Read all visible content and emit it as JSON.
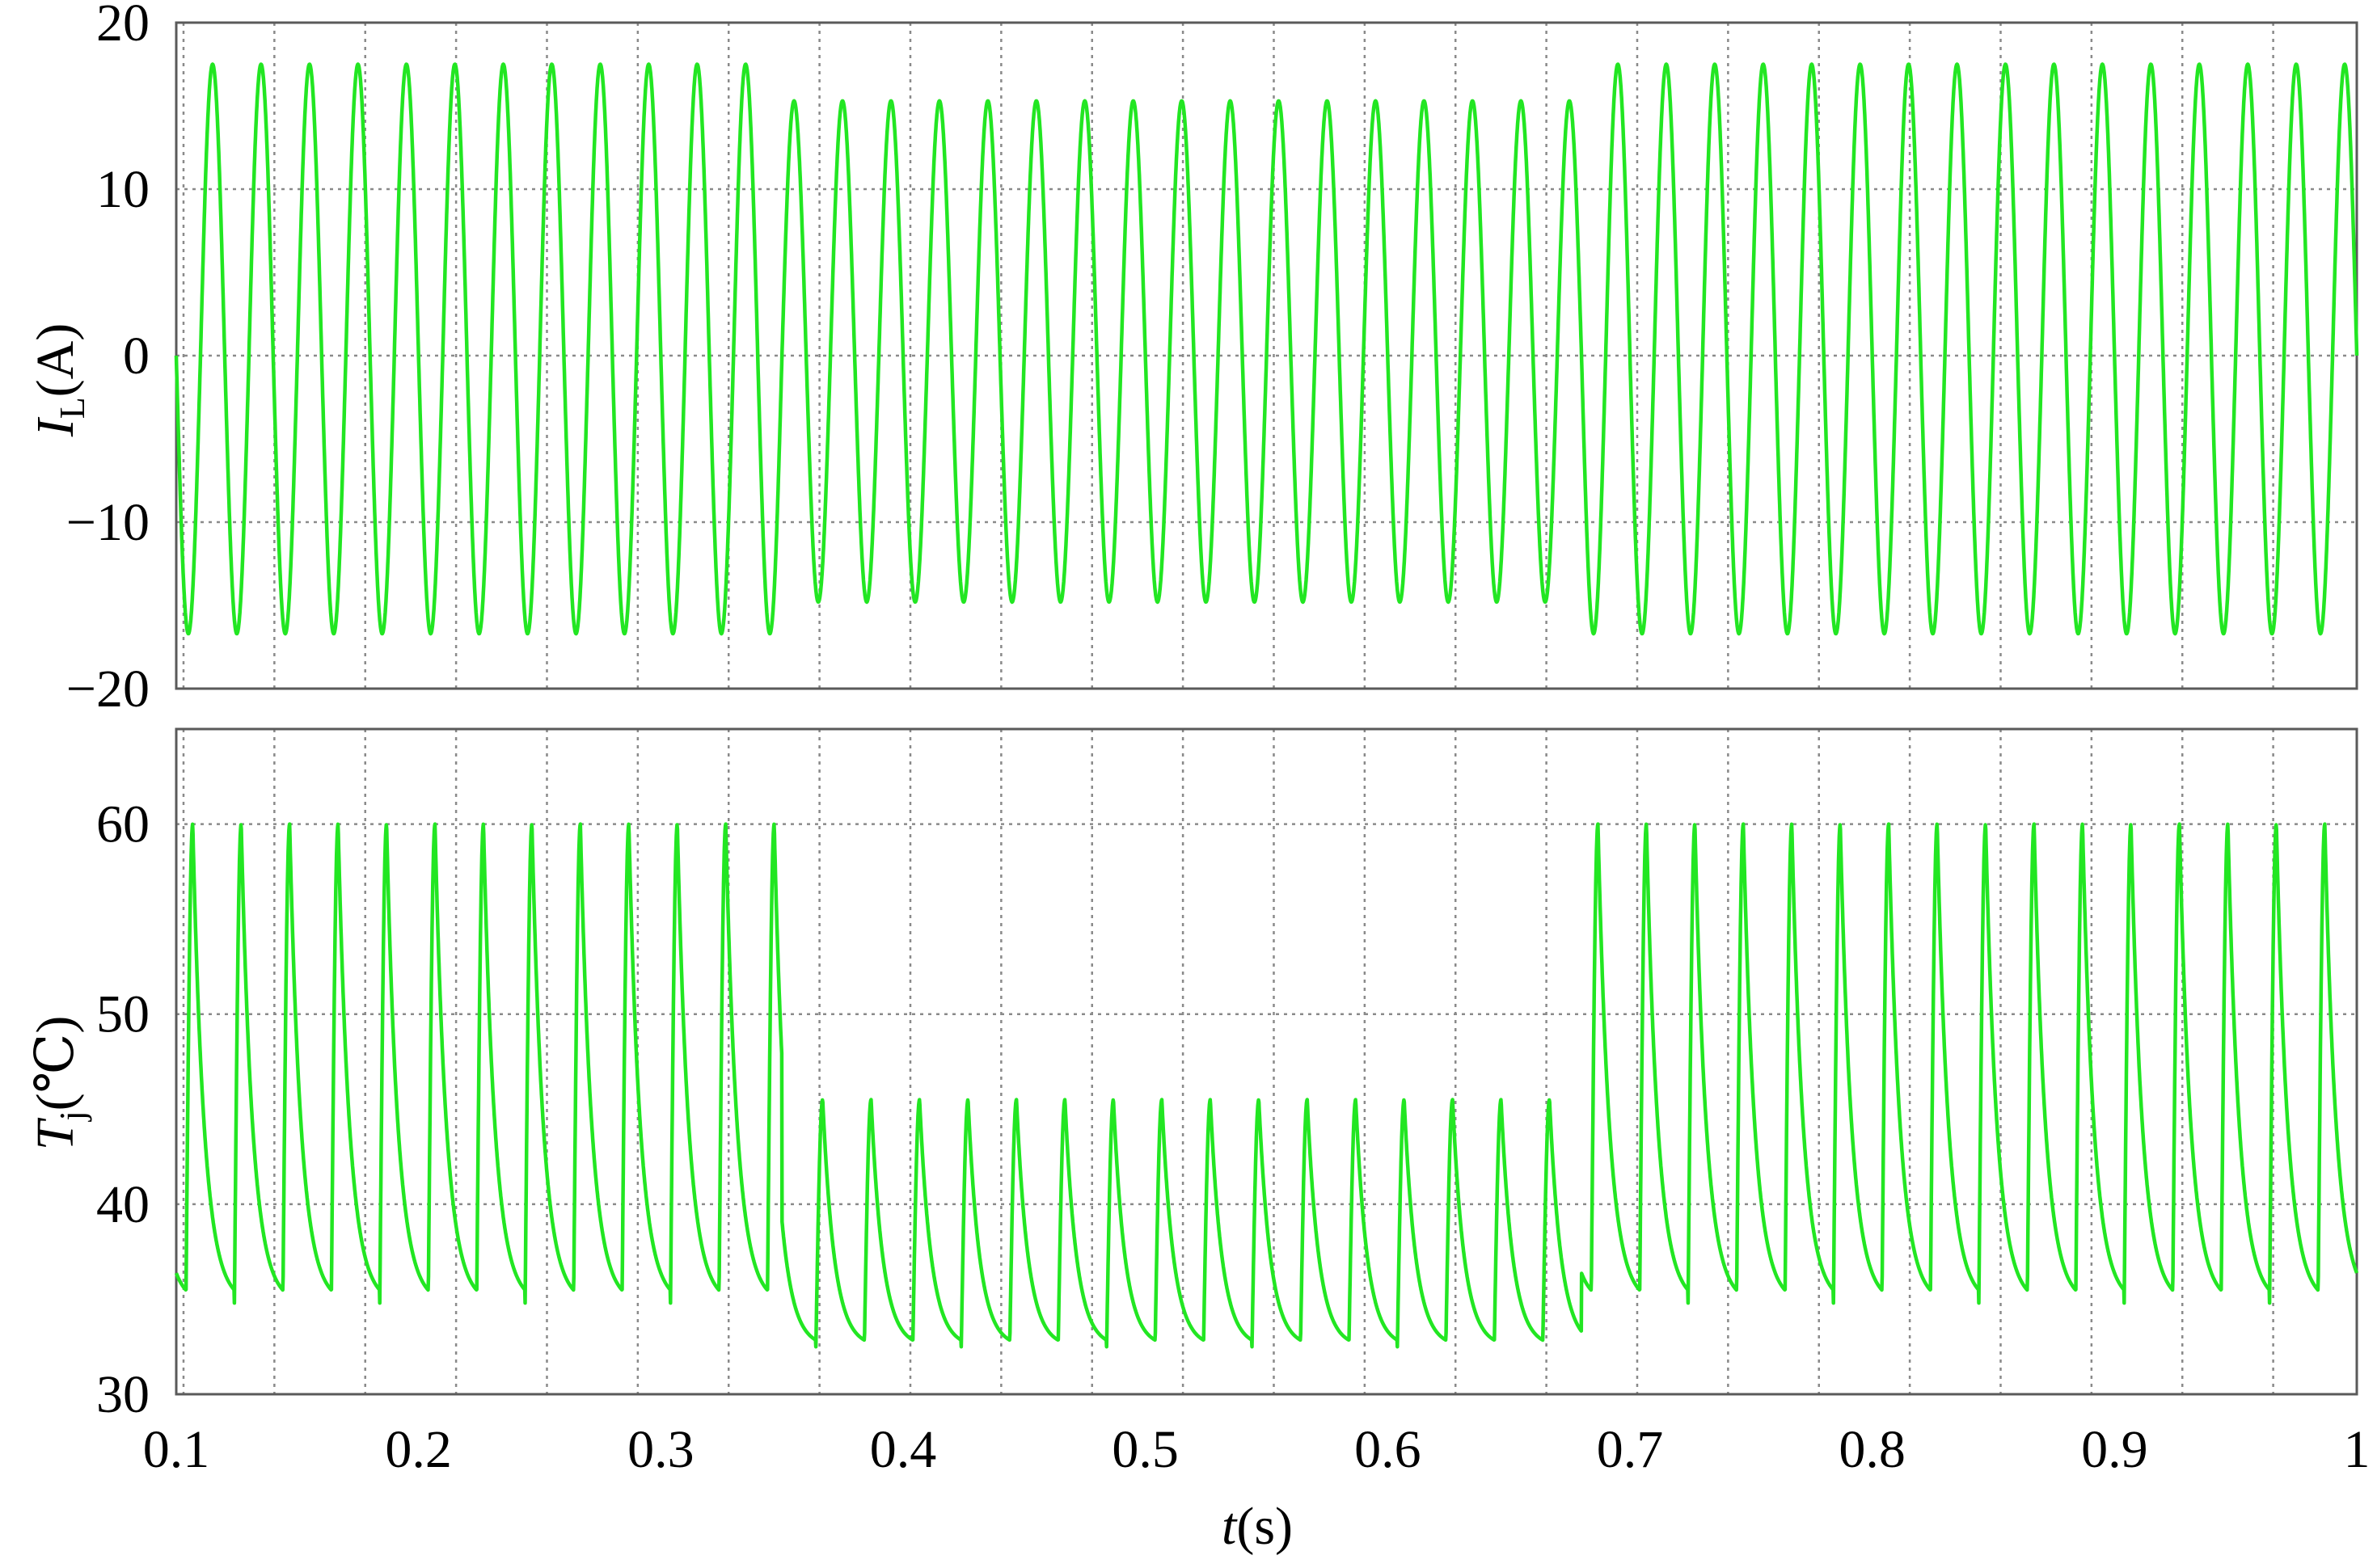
{
  "chart_data": [
    {
      "type": "line",
      "ylabel": {
        "main": "I",
        "sub": "L",
        "unit": "(A)"
      },
      "ylim": [
        -20,
        20
      ],
      "yticks": [
        "20",
        "10",
        "0",
        "−10",
        "−20"
      ],
      "xlim": [
        0.1,
        1.0
      ],
      "grid": true,
      "line_color": "#22e622",
      "series": [
        {
          "signal": "sinusoid",
          "frequency_hz": 50,
          "segments": [
            {
              "t_start": 0.1,
              "t_end": 0.35,
              "peak_pos": 17.5,
              "peak_neg": -16.7
            },
            {
              "t_start": 0.35,
              "t_end": 0.68,
              "peak_pos": 15.3,
              "peak_neg": -14.8
            },
            {
              "t_start": 0.68,
              "t_end": 1.0,
              "peak_pos": 17.5,
              "peak_neg": -16.7
            }
          ]
        }
      ]
    },
    {
      "type": "line",
      "ylabel": {
        "main": "T",
        "sub": "j",
        "unit": "(℃)"
      },
      "ylim": [
        30,
        65
      ],
      "yticks": [
        "60",
        "50",
        "40",
        "30"
      ],
      "xlim": [
        0.1,
        1.0
      ],
      "xticks": [
        "0.1",
        "0.2",
        "0.3",
        "0.4",
        "0.5",
        "0.6",
        "0.7",
        "0.8",
        "0.9",
        "1"
      ],
      "xlabel": {
        "main": "t",
        "unit": "(s)"
      },
      "grid": true,
      "line_color": "#22e622",
      "series": [
        {
          "signal": "pulsed junction temperature",
          "frequency_hz": 50,
          "segments": [
            {
              "t_start": 0.1,
              "t_end": 0.35,
              "max": 60,
              "min": 34.8
            },
            {
              "t_start": 0.35,
              "t_end": 0.68,
              "max": 45.5,
              "min": 32.5
            },
            {
              "t_start": 0.68,
              "t_end": 1.0,
              "max": 60,
              "min": 34.8
            }
          ]
        }
      ]
    }
  ]
}
